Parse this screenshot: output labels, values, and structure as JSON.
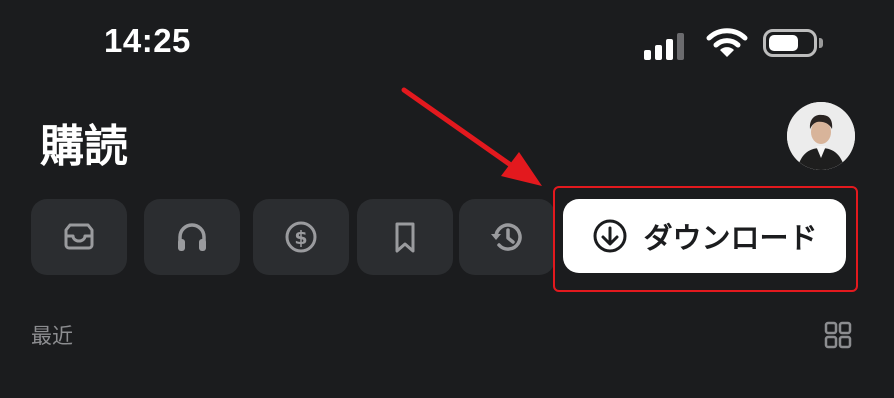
{
  "status_bar": {
    "time": "14:25",
    "icons": [
      "cellular-signal-icon",
      "wifi-icon",
      "battery-icon"
    ],
    "signal_level": 0.75,
    "battery_level": 0.6
  },
  "header": {
    "title": "購読",
    "avatar": "profile-avatar"
  },
  "filters": [
    {
      "icon": "inbox-icon"
    },
    {
      "icon": "headphones-icon"
    },
    {
      "icon": "dollar-icon"
    },
    {
      "icon": "bookmark-icon"
    },
    {
      "icon": "history-icon"
    }
  ],
  "download_button": {
    "label": "ダウンロード",
    "icon": "download-icon",
    "highlighted": true
  },
  "annotation": {
    "color": "#e3191e"
  },
  "section": {
    "label": "最近",
    "view_toggle_icon": "grid-view-icon"
  },
  "colors": {
    "background": "#1b1c1e",
    "chip": "#2b2d30",
    "icon_gray": "#9a9b9e",
    "highlight_red": "#e3191e"
  }
}
